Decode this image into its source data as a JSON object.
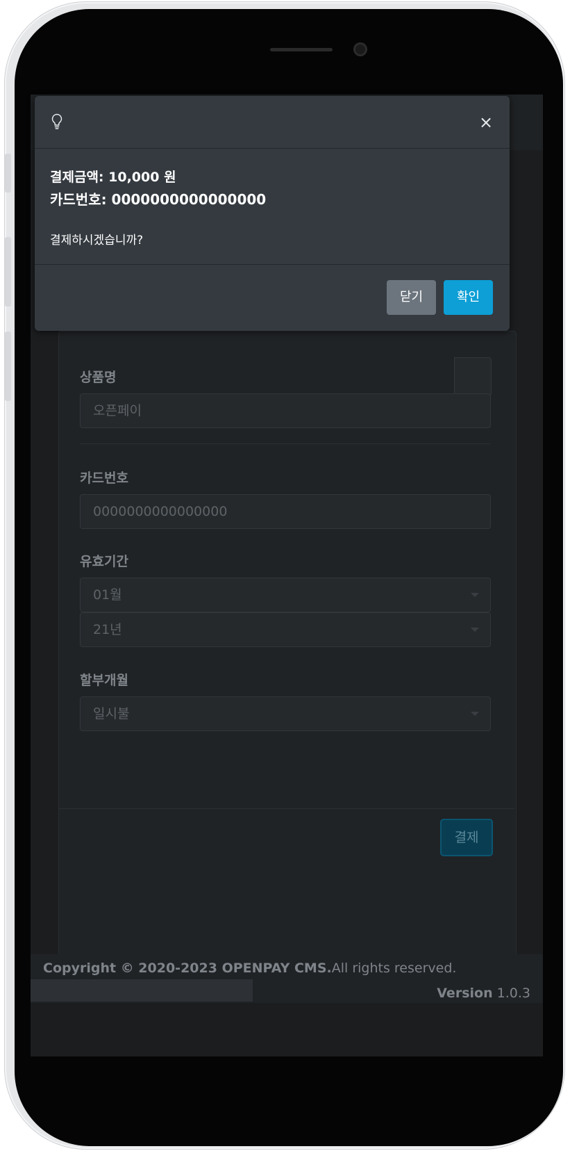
{
  "form": {
    "product_label": "상품명",
    "product_value": "오픈페이",
    "card_label": "카드번호",
    "card_value": "0000000000000000",
    "expiry_label": "유효기간",
    "expiry_month": "01월",
    "expiry_year": "21년",
    "installment_label": "할부개월",
    "installment_value": "일시불",
    "pay_button": "결제"
  },
  "footer": {
    "copyright_prefix": "Copyright © 2020-2023 ",
    "brand": "OPENPAY CMS.",
    "rights": "All rights reserved.",
    "version_label": "Version",
    "version_number": "1.0.3"
  },
  "modal": {
    "icon": "lightbulb-icon",
    "close_glyph": "×",
    "amount_text": "결제금액: 10,000 원",
    "card_text": "카드번호: 0000000000000000",
    "question": "결제하시겠습니까?",
    "close_button": "닫기",
    "confirm_button": "확인"
  },
  "colors": {
    "confirm": "#0d9fd6",
    "secondary": "#6c757d",
    "modal_bg": "#343a40"
  }
}
